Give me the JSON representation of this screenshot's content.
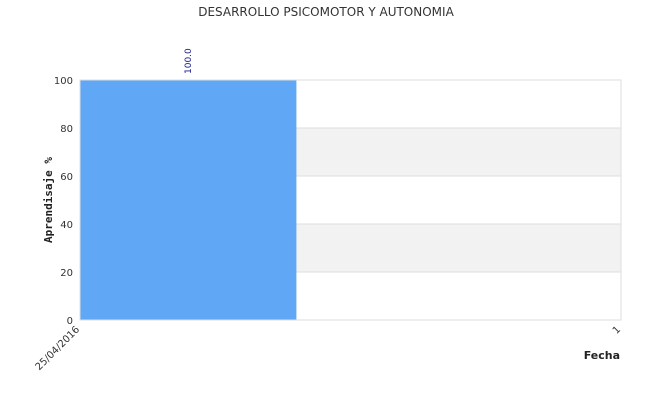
{
  "chart_data": {
    "type": "bar",
    "title": "DESARROLLO PSICOMOTOR Y AUTONOMIA",
    "ylabel": "Aprendisaje %",
    "xlabel": "Fecha",
    "categories": [
      "25/04/2016"
    ],
    "x_tick_labels": [
      "25/04/2016",
      "1"
    ],
    "values": [
      100.0
    ],
    "data_labels": [
      "100.0"
    ],
    "ylim": [
      0,
      100
    ],
    "y_ticks": [
      "0",
      "20",
      "40",
      "60",
      "80",
      "100"
    ],
    "grid": true,
    "legend": "none",
    "colors": {
      "bar": "#60a8f6",
      "band_alt": "#f2f2f2",
      "grid": "#dddddd",
      "label": "#1a1a8a"
    }
  }
}
